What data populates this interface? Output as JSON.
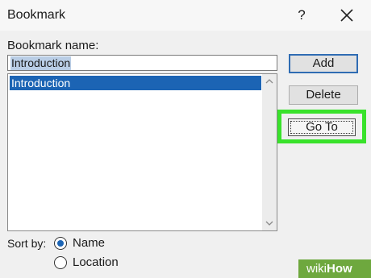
{
  "window": {
    "title": "Bookmark",
    "help_glyph": "?"
  },
  "bookmark_name": {
    "label": "Bookmark name:",
    "value": "Introduction"
  },
  "list": {
    "items": [
      "Introduction"
    ]
  },
  "buttons": {
    "add": "Add",
    "delete": "Delete",
    "goto": "Go To"
  },
  "sort": {
    "label": "Sort by:",
    "options": [
      "Name",
      "Location"
    ],
    "selected": "Name"
  },
  "watermark": {
    "prefix": "wiki",
    "suffix": "How"
  },
  "colors": {
    "selection": "#1c64b4",
    "highlight": "#39e22b",
    "watermark_bg": "#6ea83e"
  },
  "icons": [
    "help-icon",
    "close-icon",
    "scroll-up-icon",
    "scroll-down-icon"
  ]
}
